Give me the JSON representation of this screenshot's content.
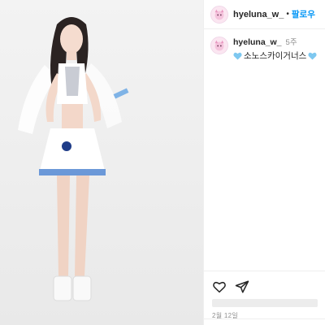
{
  "header": {
    "username": "hyeluna_w_",
    "separator": "•",
    "follow_label": "팔로우",
    "avatar_icon": "character-avatar-icon"
  },
  "caption": {
    "username": "hyeluna_w_",
    "time": "5주",
    "text": "소노스카이거너스",
    "emoji_icon": "light-blue-heart-icon",
    "emoji_color": "#7ec8f0"
  },
  "actions": {
    "like_icon": "heart-outline-icon",
    "share_icon": "paper-plane-icon"
  },
  "footer": {
    "date": "2월 12일"
  },
  "colors": {
    "accent": "#0095f6",
    "muted": "#8e8e8e",
    "text": "#262626"
  }
}
